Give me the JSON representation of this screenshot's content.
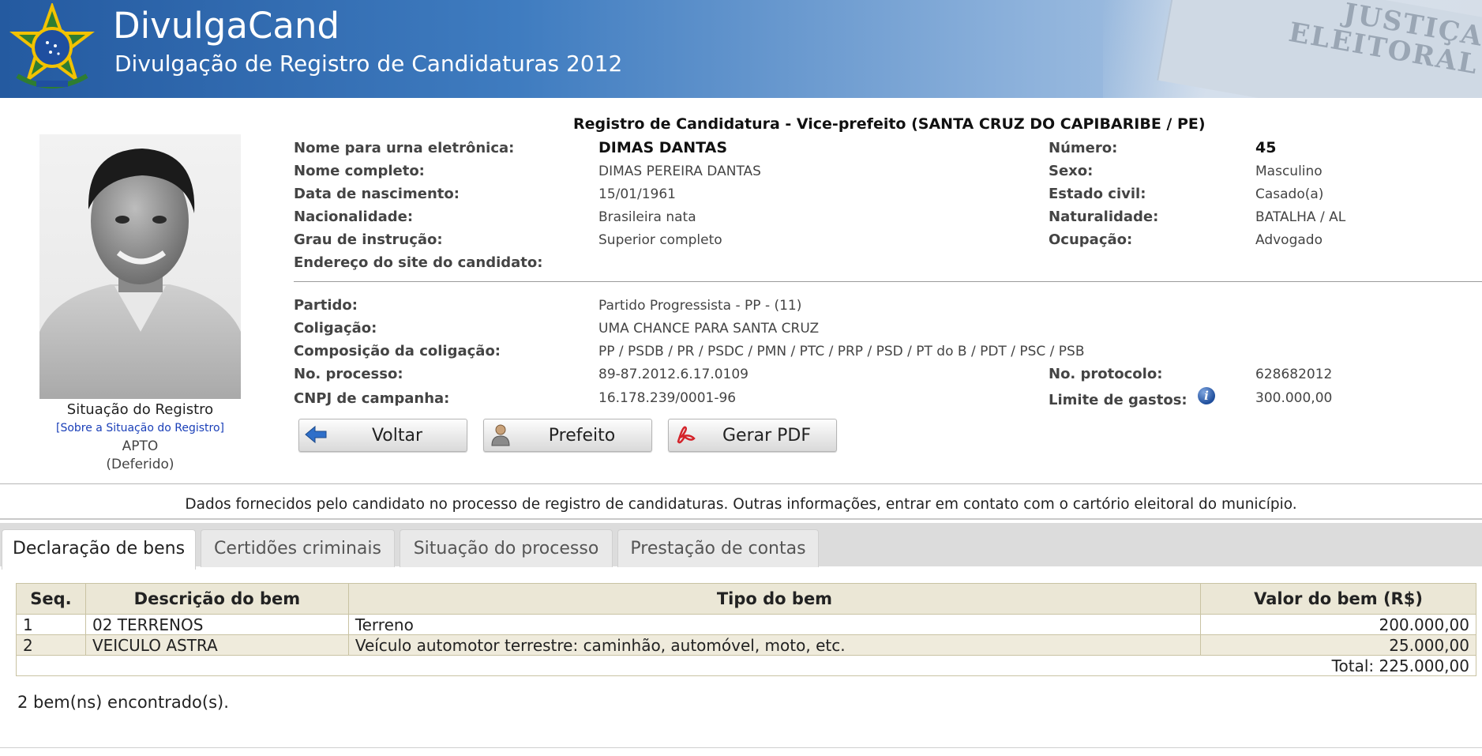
{
  "header": {
    "brand": "DivulgaCand",
    "subtitle": "Divulgação de Registro de Candidaturas 2012",
    "deco_text_1": "JUSTIÇA",
    "deco_text_2": "ELEITORAL"
  },
  "status": {
    "title": "Situação do Registro",
    "link": "[Sobre a Situação do Registro]",
    "value": "APTO",
    "detail": "(Deferido)"
  },
  "registro": {
    "title": "Registro de Candidatura - Vice-prefeito (SANTA CRUZ DO CAPIBARIBE / PE)",
    "nome_urna_label": "Nome para urna eletrônica:",
    "nome_urna": "DIMAS DANTAS",
    "nome_completo_label": "Nome completo:",
    "nome_completo": "DIMAS PEREIRA DANTAS",
    "nascimento_label": "Data de nascimento:",
    "nascimento": "15/01/1961",
    "nacionalidade_label": "Nacionalidade:",
    "nacionalidade": "Brasileira nata",
    "instrucao_label": "Grau de instrução:",
    "instrucao": "Superior completo",
    "site_label": "Endereço do site do candidato:",
    "numero_label": "Número:",
    "numero": "45",
    "sexo_label": "Sexo:",
    "sexo": "Masculino",
    "estado_civil_label": "Estado civil:",
    "estado_civil": "Casado(a)",
    "naturalidade_label": "Naturalidade:",
    "naturalidade": "BATALHA / AL",
    "ocupacao_label": "Ocupação:",
    "ocupacao": "Advogado",
    "partido_label": "Partido:",
    "partido": "Partido Progressista -  PP - (11)",
    "coligacao_label": "Coligação:",
    "coligacao": "UMA CHANCE PARA SANTA CRUZ",
    "composicao_label": "Composição da coligação:",
    "composicao": "PP / PSDB / PR / PSDC / PMN / PTC / PRP / PSD / PT do B / PDT / PSC / PSB",
    "processo_label": "No. processo:",
    "processo": "89-87.2012.6.17.0109",
    "cnpj_label": "CNPJ de campanha:",
    "cnpj": "16.178.239/0001-96",
    "protocolo_label": "No. protocolo:",
    "protocolo": "628682012",
    "limite_label": "Limite de gastos:",
    "limite": "300.000,00"
  },
  "buttons": {
    "voltar": "Voltar",
    "prefeito": "Prefeito",
    "pdf": "Gerar PDF"
  },
  "notice": "Dados fornecidos pelo candidato no processo de registro de candidaturas.  Outras informações, entrar em contato com o cartório eleitoral do município.",
  "tabs": [
    {
      "label": "Declaração de bens",
      "active": true
    },
    {
      "label": "Certidões criminais",
      "active": false
    },
    {
      "label": "Situação do processo",
      "active": false
    },
    {
      "label": "Prestação de contas",
      "active": false
    }
  ],
  "bens": {
    "headers": [
      "Seq.",
      "Descrição do bem",
      "Tipo do bem",
      "Valor do bem (R$)"
    ],
    "rows": [
      {
        "seq": "1",
        "descricao": "02 TERRENOS",
        "tipo": "Terreno",
        "valor": "200.000,00"
      },
      {
        "seq": "2",
        "descricao": "VEICULO ASTRA",
        "tipo": "Veículo automotor terrestre: caminhão, automóvel, moto, etc.",
        "valor": "25.000,00"
      }
    ],
    "total": "Total: 225.000,00",
    "found": "2 bem(ns) encontrado(s)."
  },
  "colors": {
    "header_blue": "#245aa0",
    "table_header": "#ebe7d6",
    "table_alt_row": "#efebdc",
    "link_blue": "#1a3fb8"
  }
}
